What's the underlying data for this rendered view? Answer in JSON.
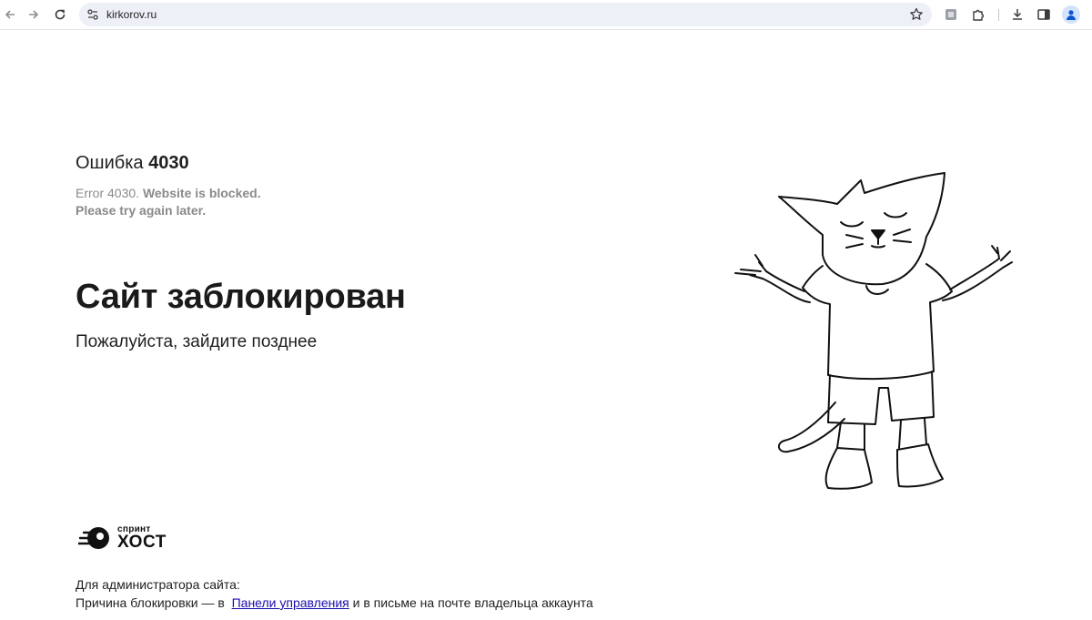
{
  "browser": {
    "url": "kirkorov.ru",
    "icons": [
      "back-arrow-icon",
      "forward-arrow-icon",
      "reload-icon",
      "site-settings-icon",
      "bookmark-star-icon",
      "extension-icon",
      "puzzle-icon",
      "download-icon",
      "side-panel-icon",
      "profile-icon"
    ]
  },
  "page": {
    "error_label": "Ошибка",
    "error_code": "4030",
    "error_en_prefix": "Error 4030.",
    "error_en_bold": "Website is blocked.",
    "error_en_line2": "Please try again later.",
    "headline": "Сайт заблокирован",
    "subline": "Пожалуйста, зайдите позднее"
  },
  "logo": {
    "small": "спринт",
    "big": "ХОСТ"
  },
  "footer": {
    "line1": "Для администратора сайта:",
    "line2_prefix": "Причина блокировки — в",
    "link_text": "Панели управления",
    "line2_suffix": "и в письме на почте владельца аккаунта"
  },
  "colors": {
    "link": "#1a0dab",
    "muted_text": "#8a8a8a",
    "omnibox_bg": "#edf0f7"
  }
}
